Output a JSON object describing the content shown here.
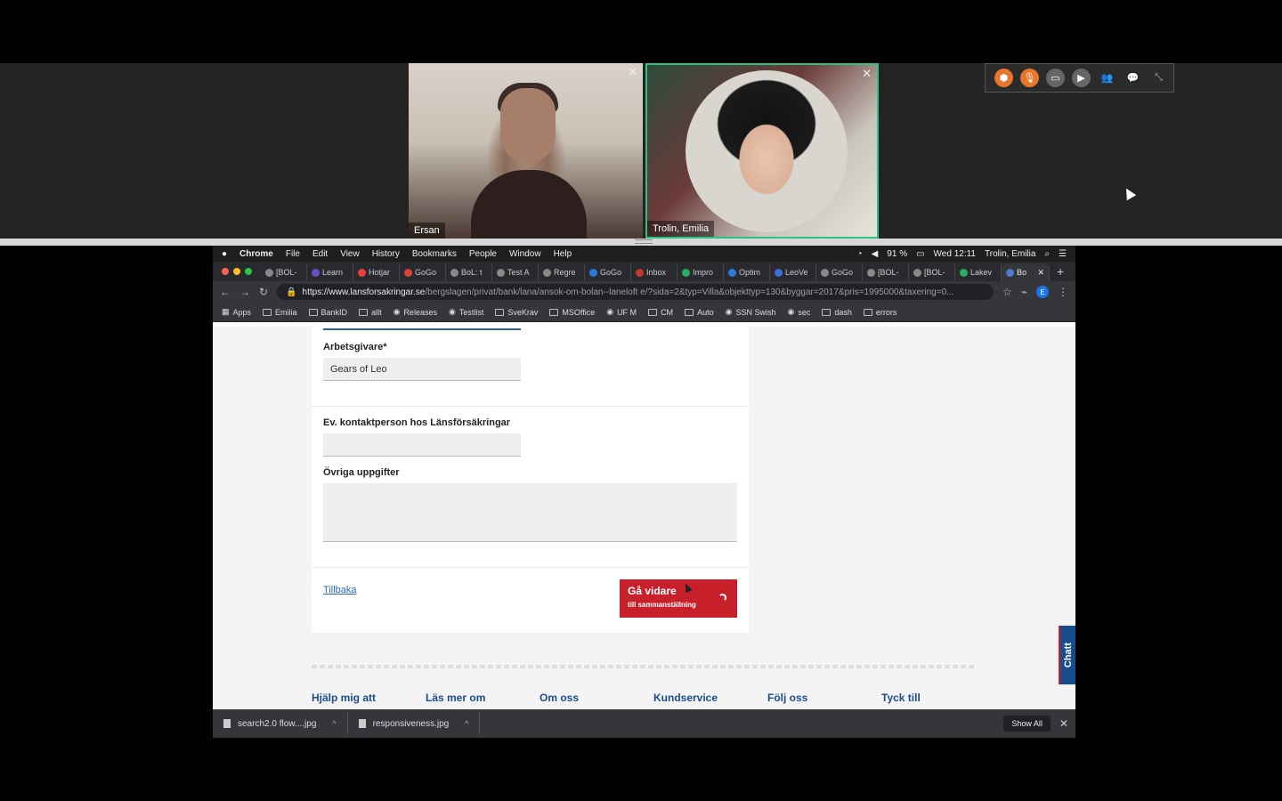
{
  "call": {
    "participants": [
      {
        "name": "Ersan"
      },
      {
        "name": "Trolin, Emilia"
      }
    ],
    "close_glyph": "✕",
    "toolbar_icons": [
      "hexagon-icon",
      "mute-icon",
      "screen-share-icon",
      "camera-icon",
      "participants-icon",
      "chat-icon",
      "collapse-icon"
    ],
    "accent_active": "#2ec27e",
    "accent_muted": "#e8762b"
  },
  "menubar": {
    "app_name": "Chrome",
    "menus": [
      "File",
      "Edit",
      "View",
      "History",
      "Bookmarks",
      "People",
      "Window",
      "Help"
    ],
    "battery": "91 %",
    "clock": "Wed 12:11",
    "user": "Trolin, Emilia"
  },
  "tabs": [
    "[BOL-",
    "Learn",
    "Hotjar",
    "GoGo",
    "BoL: t",
    "Test A",
    "Regre",
    "GoGo",
    "Inbox",
    "Impro",
    "Optim",
    "LeoVe",
    "GoGo",
    "[BOL-",
    "[BOL-",
    "Lakev",
    "Bo"
  ],
  "address": {
    "host": "https://www.lansforsakringar.se",
    "path": "/bergslagen/privat/bank/lana/ansok-om-bolan--laneloft e/?sida=2&typ=Villa&objekttyp=130&byggar=2017&pris=1995000&taxering=0..."
  },
  "bookmarks": [
    "Apps",
    "Emilia",
    "BankID",
    "allt",
    "Releases",
    "Testlist",
    "SveKrav",
    "MSOffice",
    "UF M",
    "CM",
    "Auto",
    "SSN Swish",
    "sec",
    "dash",
    "errors"
  ],
  "form": {
    "employer_label": "Arbetsgivare*",
    "employer_value": "Gears of Leo",
    "contact_label": "Ev. kontaktperson hos Länsförsäkringar",
    "contact_value": "",
    "other_label": "Övriga uppgifter",
    "other_value": "",
    "back_label": "Tillbaka",
    "next_label": "Gå vidare",
    "next_sublabel": "till sammanställning"
  },
  "footer": [
    "Hjälp mig att",
    "Läs mer om",
    "Om oss",
    "Kundservice",
    "Följ oss",
    "Tyck till"
  ],
  "chat_tab": "Chatt",
  "downloads": {
    "items": [
      "search2.0 flow....jpg",
      "responsiveness.jpg"
    ],
    "show_all": "Show All"
  }
}
